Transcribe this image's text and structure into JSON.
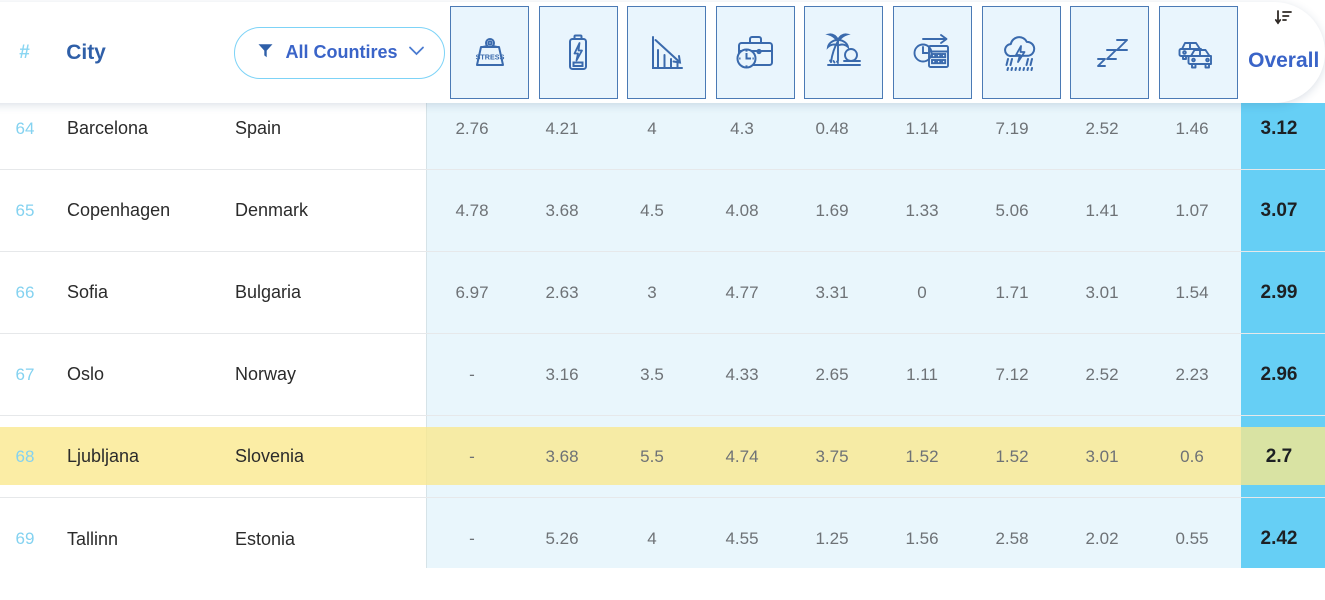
{
  "table": {
    "header": {
      "rank_symbol": "#",
      "city_label": "City",
      "filter": {
        "label": "All Countires",
        "funnel_icon": "funnel-icon",
        "chevron_icon": "chevron-down-icon"
      },
      "overall_label": "Overall",
      "sort_icon": "sort-descending-icon",
      "metric_columns": [
        {
          "icon": "stress-weight-icon",
          "icon_text": "STRESS"
        },
        {
          "icon": "battery-charge-icon",
          "icon_text": ""
        },
        {
          "icon": "declining-chart-icon",
          "icon_text": ""
        },
        {
          "icon": "briefcase-clock-icon",
          "icon_text": ""
        },
        {
          "icon": "palm-tree-sunset-icon",
          "icon_text": ""
        },
        {
          "icon": "calendar-clock-arrow-icon",
          "icon_text": ""
        },
        {
          "icon": "storm-cloud-rain-icon",
          "icon_text": ""
        },
        {
          "icon": "sleep-zzz-icon",
          "icon_text": ""
        },
        {
          "icon": "traffic-cars-icon",
          "icon_text": ""
        }
      ]
    },
    "colors": {
      "data_tint": "#e9f6fc",
      "overall_cell": "#66cff5",
      "highlight_row": "#fae88c",
      "rank_text": "#84d2f0",
      "accent_blue": "#3a64c8",
      "icon_box_fill": "#e9f5fd",
      "icon_box_border": "#4b7ab5"
    },
    "rows": [
      {
        "rank": "64",
        "city": "Barcelona",
        "country": "Spain",
        "metrics": [
          "2.76",
          "4.21",
          "4",
          "4.3",
          "0.48",
          "1.14",
          "7.19",
          "2.52",
          "1.46"
        ],
        "overall": "3.12",
        "highlighted": false
      },
      {
        "rank": "65",
        "city": "Copenhagen",
        "country": "Denmark",
        "metrics": [
          "4.78",
          "3.68",
          "4.5",
          "4.08",
          "1.69",
          "1.33",
          "5.06",
          "1.41",
          "1.07"
        ],
        "overall": "3.07",
        "highlighted": false
      },
      {
        "rank": "66",
        "city": "Sofia",
        "country": "Bulgaria",
        "metrics": [
          "6.97",
          "2.63",
          "3",
          "4.77",
          "3.31",
          "0",
          "1.71",
          "3.01",
          "1.54"
        ],
        "overall": "2.99",
        "highlighted": false
      },
      {
        "rank": "67",
        "city": "Oslo",
        "country": "Norway",
        "metrics": [
          "-",
          "3.16",
          "3.5",
          "4.33",
          "2.65",
          "1.11",
          "7.12",
          "2.52",
          "2.23"
        ],
        "overall": "2.96",
        "highlighted": false
      },
      {
        "rank": "68",
        "city": "Ljubljana",
        "country": "Slovenia",
        "metrics": [
          "-",
          "3.68",
          "5.5",
          "4.74",
          "3.75",
          "1.52",
          "1.52",
          "3.01",
          "0.6"
        ],
        "overall": "2.7",
        "highlighted": true
      },
      {
        "rank": "69",
        "city": "Tallinn",
        "country": "Estonia",
        "metrics": [
          "-",
          "5.26",
          "4",
          "4.55",
          "1.25",
          "1.56",
          "2.58",
          "2.02",
          "0.55"
        ],
        "overall": "2.42",
        "highlighted": false
      }
    ]
  }
}
